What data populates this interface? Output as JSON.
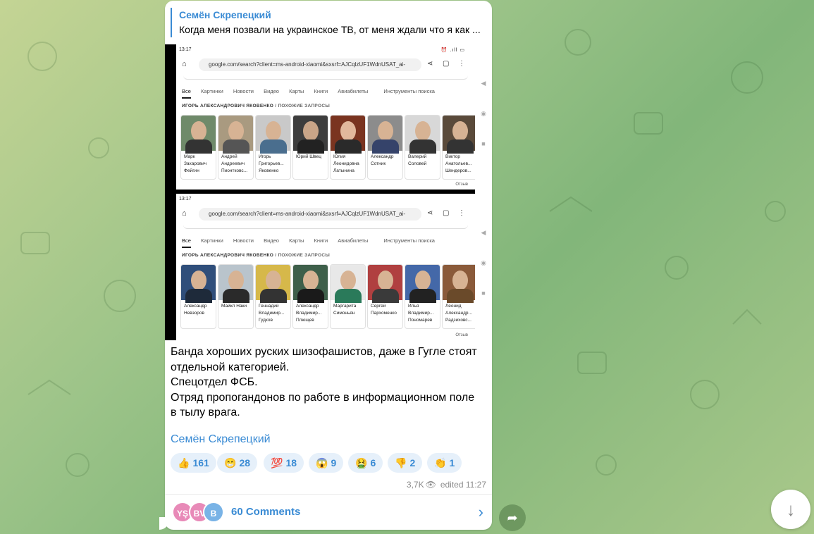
{
  "post": {
    "reply_author": "Семён Скрепецкий",
    "reply_text": "Когда меня позвали на украинское ТВ, от меня ждали что я как ...",
    "body_lines": [
      "Банда хороших руских шизофашистов, даже в Гугле стоят",
      "отдельной категорией.",
      "Спецотдел ФСБ.",
      "Отряд пропогандонов по работе в информационном поле",
      "в тылу врага."
    ],
    "signature": "Семён Скрепецкий",
    "views": "3,7K",
    "edited": "edited 11:27"
  },
  "screenshot": {
    "time": "13:17",
    "status_icons": "⏰ .ıll ▭",
    "url": "google.com/search?client=ms-android-xiaomi&sxsrf=AJCqlzUF1WdnUSAT_ai-",
    "tabs": [
      "Все",
      "Картинки",
      "Новости",
      "Видео",
      "Карты",
      "Книги",
      "Авиабилеты"
    ],
    "tools": "Инструменты поиска",
    "related_title": "ИГОРЬ АЛЕКСАНДРОВИЧ ЯКОВЕНКО",
    "related_sub": "/ ПОХОЖИЕ ЗАПРОСЫ",
    "other": "Отзыв",
    "people1": [
      "Марк Захарович Фейгин",
      "Андрей Андреевич Пионтковс...",
      "Игорь Григорьев... Яковенко",
      "Юрий Швец",
      "Юлия Леонидовна Латынина",
      "Александр Сотник",
      "Валерий Соловей",
      "Виктор Анатольев... Шендеров..."
    ],
    "people2": [
      "Александр Невзоров",
      "Майкл Наки",
      "Геннадий Владимир... Гудков",
      "Александр Владимир... Плющев",
      "Маргарита Симоньян",
      "Сергей Пархоменко",
      "Илья Владимир... Пономарев",
      "Леонид Александр... Радзиховс..."
    ]
  },
  "reactions": [
    {
      "emoji": "👍",
      "count": "161"
    },
    {
      "emoji": "😁",
      "count": "28"
    },
    {
      "emoji": "💯",
      "count": "18"
    },
    {
      "emoji": "😱",
      "count": "9"
    },
    {
      "emoji": "🤮",
      "count": "6"
    },
    {
      "emoji": "👎",
      "count": "2"
    },
    {
      "emoji": "👏",
      "count": "1"
    }
  ],
  "comments": {
    "label": "60 Comments",
    "avatars": [
      {
        "initials": "YŞ",
        "color": "#e88ab8"
      },
      {
        "initials": "BV",
        "color": "#e88ab8"
      },
      {
        "initials": "B",
        "color": "#79b3e6"
      }
    ]
  },
  "icons": {
    "share": "share-icon",
    "scroll_down": "arrow-down-icon",
    "chevron": "chevron-right-icon",
    "eye": "eye-icon"
  },
  "colors": {
    "accent": "#3a8bd4",
    "reaction_bg": "#e6f0fa"
  }
}
